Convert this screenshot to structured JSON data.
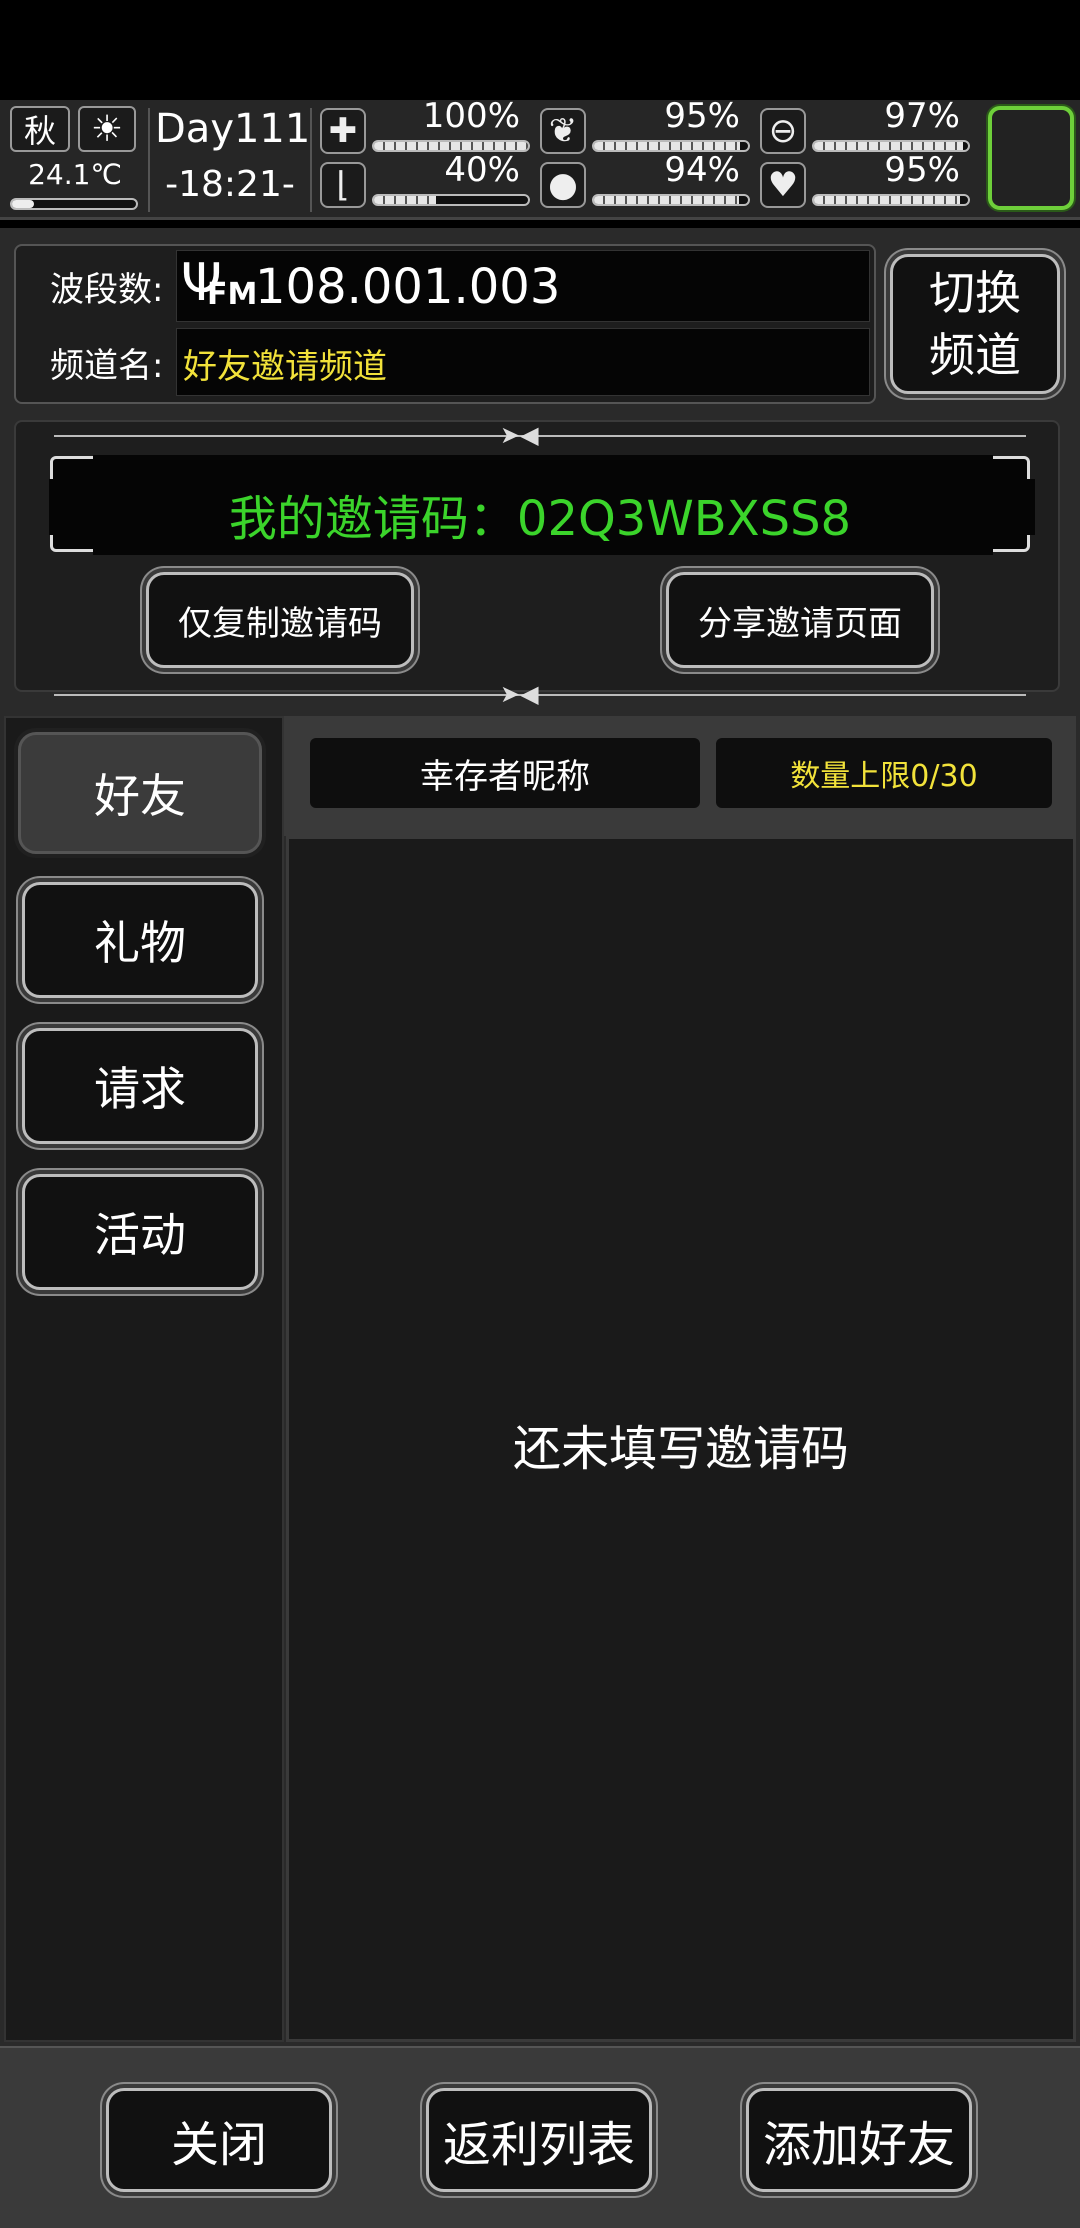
{
  "status": {
    "season": "秋",
    "temperature": "24.1℃",
    "day": "Day111",
    "time": "-18:21-",
    "stats": [
      {
        "name": "health",
        "icon": "medkit-icon",
        "glyph": "✚",
        "value": "100%",
        "level": 1.0
      },
      {
        "name": "stomach",
        "icon": "stomach-icon",
        "glyph": "❦",
        "value": "95%",
        "level": 0.95
      },
      {
        "name": "mood",
        "icon": "capsule-icon",
        "glyph": "⊖",
        "value": "97%",
        "level": 0.97
      },
      {
        "name": "stamina",
        "icon": "boot-icon",
        "glyph": "⌊",
        "value": "40%",
        "level": 0.4
      },
      {
        "name": "water",
        "icon": "water-drop-icon",
        "glyph": "●",
        "value": "94%",
        "level": 0.94
      },
      {
        "name": "heart",
        "icon": "heart-icon",
        "glyph": "♥",
        "value": "95%",
        "level": 0.95
      }
    ]
  },
  "radio": {
    "band_label": "波段数:",
    "band_value": "108.001.003",
    "fm_label": "FM",
    "channel_label": "频道名:",
    "channel_value": "好友邀请频道",
    "switch_button": "切换\n频道"
  },
  "invite": {
    "code_text": "我的邀请码：02Q3WBXSS8",
    "copy_button": "仅复制邀请码",
    "share_button": "分享邀请页面"
  },
  "tabs": [
    "好友",
    "礼物",
    "请求",
    "活动"
  ],
  "list": {
    "column_name": "幸存者昵称",
    "column_limit": "数量上限0/30",
    "empty_text": "还未填写邀请码"
  },
  "footer": {
    "close": "关闭",
    "rebate": "返利列表",
    "add_friend": "添加好友"
  },
  "colors": {
    "accent_green": "#3bd42b",
    "highlight_yellow": "#f2e23a",
    "frame_green": "#6ecf3a"
  }
}
